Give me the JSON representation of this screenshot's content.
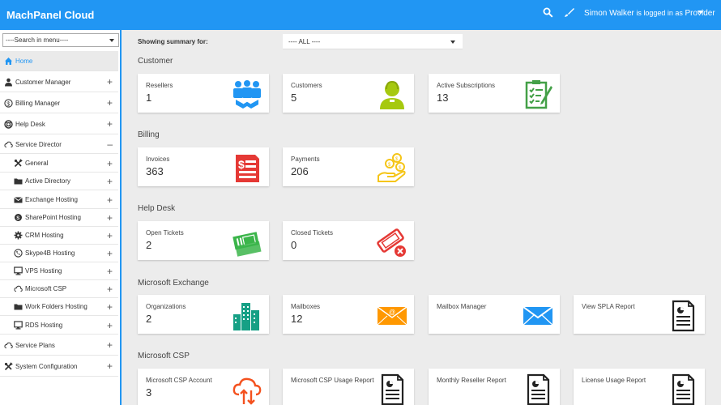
{
  "header": {
    "app_title": "MachPanel Cloud",
    "user_name": "Simon Walker",
    "logged_in_text": "is logged in as",
    "role": "Provider"
  },
  "sidebar": {
    "search_placeholder": "----Search in menu----",
    "items": [
      {
        "label": "Home",
        "icon": "home-icon"
      },
      {
        "label": "Customer Manager",
        "icon": "person-icon"
      },
      {
        "label": "Billing Manager",
        "icon": "dollar-icon"
      },
      {
        "label": "Help Desk",
        "icon": "lifebuoy-icon"
      },
      {
        "label": "Service Director",
        "icon": "cloud-icon",
        "toggle": "–"
      },
      {
        "label": "General",
        "icon": "tools-icon"
      },
      {
        "label": "Active Directory",
        "icon": "folder-icon"
      },
      {
        "label": "Exchange Hosting",
        "icon": "envelope-icon"
      },
      {
        "label": "SharePoint Hosting",
        "icon": "sharepoint-icon"
      },
      {
        "label": "CRM Hosting",
        "icon": "gear-icon"
      },
      {
        "label": "Skype4B Hosting",
        "icon": "phone-icon"
      },
      {
        "label": "VPS Hosting",
        "icon": "monitor-icon"
      },
      {
        "label": "Microsoft CSP",
        "icon": "cloud-icon"
      },
      {
        "label": "Work Folders Hosting",
        "icon": "folder-icon"
      },
      {
        "label": "RDS Hosting",
        "icon": "monitor-icon"
      },
      {
        "label": "Service Plans",
        "icon": "cloud-icon"
      },
      {
        "label": "System Configuration",
        "icon": "tools-icon"
      }
    ],
    "plus_symbol": "+"
  },
  "summary": {
    "label": "Showing summary for:",
    "selected": "---- ALL ----"
  },
  "sections": [
    {
      "title": "Customer",
      "cards": [
        {
          "label": "Resellers",
          "value": "1",
          "icon": "team-handshake-icon",
          "color": "#2196f3"
        },
        {
          "label": "Customers",
          "value": "5",
          "icon": "customer-icon",
          "color": "#a6c90f"
        },
        {
          "label": "Active Subscriptions",
          "value": "13",
          "icon": "checklist-icon",
          "color": "#43a047"
        }
      ]
    },
    {
      "title": "Billing",
      "cards": [
        {
          "label": "Invoices",
          "value": "363",
          "icon": "invoice-icon",
          "color": "#e53935"
        },
        {
          "label": "Payments",
          "value": "206",
          "icon": "coins-hand-icon",
          "color": "#f5c518"
        }
      ]
    },
    {
      "title": "Help Desk",
      "cards": [
        {
          "label": "Open Tickets",
          "value": "2",
          "icon": "tickets-icon",
          "color": "#3bb54a"
        },
        {
          "label": "Closed Tickets",
          "value": "0",
          "icon": "closed-ticket-icon",
          "color": "#e53935"
        }
      ]
    },
    {
      "title": "Microsoft Exchange",
      "cards": [
        {
          "label": "Organizations",
          "value": "2",
          "icon": "buildings-icon",
          "color": "#16a085"
        },
        {
          "label": "Mailboxes",
          "value": "12",
          "icon": "mail-at-icon",
          "color": "#ff9800"
        },
        {
          "label": "Mailbox Manager",
          "value": "",
          "icon": "envelope-icon",
          "color": "#2196f3"
        },
        {
          "label": "View SPLA Report",
          "value": "",
          "icon": "report-icon",
          "color": "#222222"
        }
      ]
    },
    {
      "title": "Microsoft CSP",
      "cards": [
        {
          "label": "Microsoft CSP Account",
          "value": "3",
          "icon": "cloud-transfer-icon",
          "color": "#f4511e"
        },
        {
          "label": "Microsoft CSP Usage Report",
          "value": "",
          "icon": "report-icon",
          "color": "#222222"
        },
        {
          "label": "Monthly Reseller Report",
          "value": "",
          "icon": "report-icon",
          "color": "#222222"
        },
        {
          "label": "License Usage Report",
          "value": "",
          "icon": "report-icon",
          "color": "#222222"
        }
      ]
    }
  ],
  "colors": {
    "accent": "#2196f3"
  }
}
